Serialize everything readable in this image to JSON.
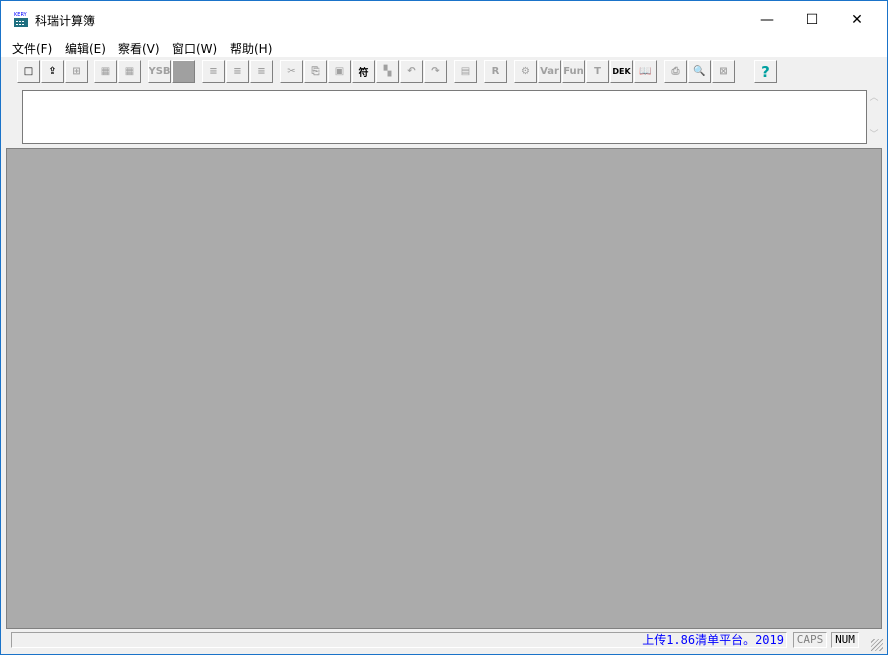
{
  "window": {
    "title": "科瑞计算簿",
    "icon_label": "KERY",
    "controls": {
      "minimize": "—",
      "maximize": "☐",
      "close": "✕"
    }
  },
  "menu": [
    "文件(F)",
    "编辑(E)",
    "察看(V)",
    "窗口(W)",
    "帮助(H)"
  ],
  "toolbar": [
    {
      "name": "new",
      "glyph": "□",
      "enabled": true
    },
    {
      "name": "open",
      "glyph": "⇪",
      "enabled": true
    },
    {
      "name": "insert-sheet",
      "glyph": "⊞",
      "enabled": false
    },
    {
      "name": "export",
      "glyph": "▦",
      "enabled": false
    },
    {
      "name": "export-file",
      "glyph": "▦",
      "enabled": false
    },
    {
      "name": "ysb",
      "glyph": "YSB",
      "enabled": false
    },
    {
      "name": "block",
      "glyph": "■",
      "enabled": false
    },
    {
      "name": "indent-left",
      "glyph": "≡",
      "enabled": false
    },
    {
      "name": "indent-return",
      "glyph": "≡",
      "enabled": false
    },
    {
      "name": "clear-lines",
      "glyph": "≡",
      "enabled": false
    },
    {
      "name": "cut",
      "glyph": "✂",
      "enabled": false
    },
    {
      "name": "copy",
      "glyph": "⎘",
      "enabled": false
    },
    {
      "name": "paste",
      "glyph": "▣",
      "enabled": false
    },
    {
      "name": "symbol",
      "glyph": "符",
      "enabled": true
    },
    {
      "name": "replace",
      "glyph": "▚",
      "enabled": false
    },
    {
      "name": "undo",
      "glyph": "↶",
      "enabled": false
    },
    {
      "name": "redo",
      "glyph": "↷",
      "enabled": false
    },
    {
      "name": "properties",
      "glyph": "▤",
      "enabled": false
    },
    {
      "name": "result",
      "glyph": "R",
      "enabled": false
    },
    {
      "name": "settings",
      "glyph": "⚙",
      "enabled": false
    },
    {
      "name": "variables",
      "glyph": "Var",
      "enabled": false
    },
    {
      "name": "functions",
      "glyph": "Fun",
      "enabled": false
    },
    {
      "name": "text",
      "glyph": "T",
      "enabled": false
    },
    {
      "name": "dek",
      "glyph": "DEK",
      "enabled": true
    },
    {
      "name": "manual",
      "glyph": "📖",
      "enabled": true
    },
    {
      "name": "print",
      "glyph": "⎙",
      "enabled": false
    },
    {
      "name": "print-preview",
      "glyph": "🔍",
      "enabled": false
    },
    {
      "name": "close-doc",
      "glyph": "⊠",
      "enabled": false
    },
    {
      "name": "help",
      "glyph": "?",
      "enabled": true
    }
  ],
  "editor": {
    "value": ""
  },
  "statusbar": {
    "message": "上传1.86清单平台。2019",
    "caps": "CAPS",
    "num": "NUM"
  },
  "colors": {
    "mdi_bg": "#ababab",
    "status_text": "#0000ff"
  }
}
